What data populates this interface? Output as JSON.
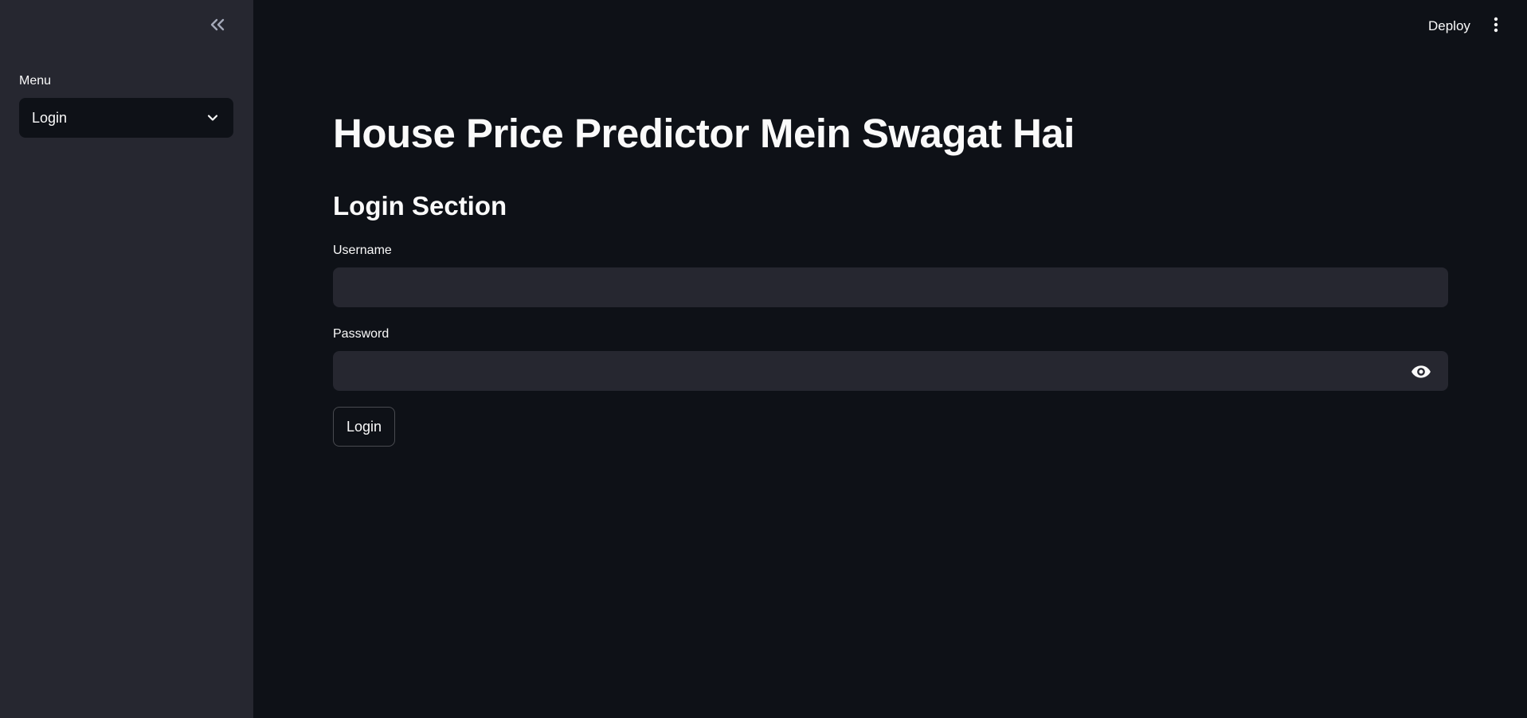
{
  "header": {
    "deploy_label": "Deploy"
  },
  "sidebar": {
    "collapse_icon": "double-chevron-left-icon",
    "menu_label": "Menu",
    "select": {
      "value": "Login"
    }
  },
  "main": {
    "title": "House Price Predictor Mein Swagat Hai",
    "section_title": "Login Section",
    "username": {
      "label": "Username",
      "value": ""
    },
    "password": {
      "label": "Password",
      "value": ""
    },
    "login_button": "Login"
  },
  "colors": {
    "background": "#0e1117",
    "sidebar": "#262730",
    "input_bg": "#262730",
    "text": "#fafafa"
  }
}
